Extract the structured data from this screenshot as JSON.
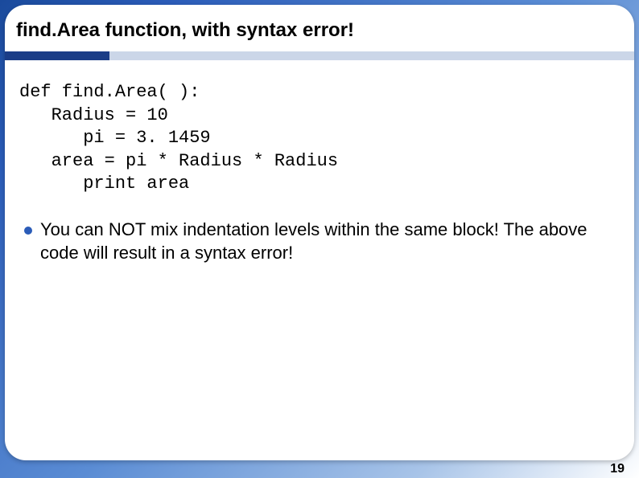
{
  "slide": {
    "title": "find.Area function, with syntax error!",
    "code": "def find.Area( ):\n   Radius = 10\n      pi = 3. 1459\n   area = pi * Radius * Radius\n      print area",
    "bullet1": "You can NOT mix indentation levels within the same block! The above code will result in a syntax error!",
    "pageNumber": "19"
  }
}
